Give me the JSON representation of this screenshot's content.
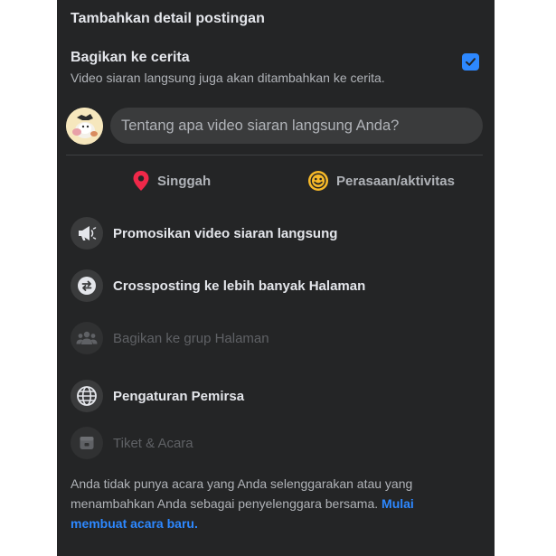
{
  "header": {
    "title": "Tambahkan detail postingan"
  },
  "story": {
    "title": "Bagikan ke cerita",
    "subtitle": "Video siaran langsung juga akan ditambahkan ke cerita.",
    "checked": true
  },
  "composer": {
    "placeholder": "Tentang apa video siaran langsung Anda?"
  },
  "actions": [
    {
      "label": "Singgah",
      "icon": "location-pin-icon"
    },
    {
      "label": "Perasaan/aktivitas",
      "icon": "smiley-icon"
    }
  ],
  "options": [
    {
      "label": "Promosikan video siaran langsung",
      "icon": "megaphone-icon",
      "enabled": true
    },
    {
      "label": "Crossposting ke lebih banyak Halaman",
      "icon": "crosspost-arrows-icon",
      "enabled": true
    },
    {
      "label": "Bagikan ke grup Halaman",
      "icon": "group-icon",
      "enabled": false
    },
    {
      "label": "Pengaturan Pemirsa",
      "icon": "globe-icon",
      "enabled": true
    },
    {
      "label": "Tiket & Acara",
      "icon": "ticket-icon",
      "enabled": false
    }
  ],
  "footer": {
    "text": "Anda tidak punya acara yang Anda selenggarakan atau yang menambahkan Anda sebagai penyelenggara bersama. ",
    "link": "Mulai membuat acara baru."
  },
  "colors": {
    "panel_bg": "#242526",
    "accent": "#2d88ff",
    "pin": "#f02849",
    "smiley": "#f7b928"
  }
}
